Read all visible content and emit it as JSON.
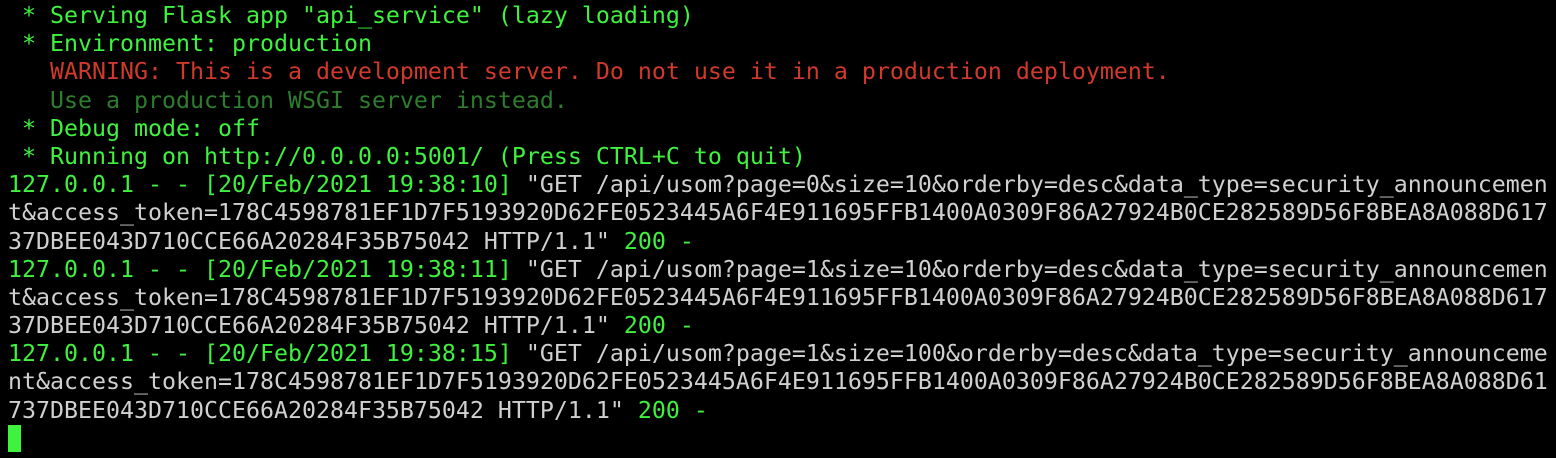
{
  "colors": {
    "green": "#3ef23e",
    "white": "#d0d0d0",
    "red": "#d0392b",
    "dark_green": "#2e7d2e"
  },
  "lines": {
    "serving": " * Serving Flask app \"api_service\" (lazy loading)",
    "environment": " * Environment: production",
    "warning": "   WARNING: This is a development server. Do not use it in a production deployment.",
    "wsgi": "   Use a production WSGI server instead.",
    "debug": " * Debug mode: off",
    "running": " * Running on http://0.0.0.0:5001/ (Press CTRL+C to quit)"
  },
  "requests": [
    {
      "prefix": "127.0.0.1 - - [20/Feb/2021 19:38:10] ",
      "l1": "\"GET /api/usom?page=0&size=10&orderby=desc&data_type=security_announcemen",
      "l2": "t&access_token=178C4598781EF1D7F5193920D62FE0523445A6F4E911695FFB1400A0309F86A27924B0CE282589D56F8BEA8A088D617",
      "l3": "37DBEE043D710CCE66A20284F35B75042 HTTP/1.1\" ",
      "status": "200 -"
    },
    {
      "prefix": "127.0.0.1 - - [20/Feb/2021 19:38:11] ",
      "l1": "\"GET /api/usom?page=1&size=10&orderby=desc&data_type=security_announcemen",
      "l2": "t&access_token=178C4598781EF1D7F5193920D62FE0523445A6F4E911695FFB1400A0309F86A27924B0CE282589D56F8BEA8A088D617",
      "l3": "37DBEE043D710CCE66A20284F35B75042 HTTP/1.1\" ",
      "status": "200 -"
    },
    {
      "prefix": "127.0.0.1 - - [20/Feb/2021 19:38:15] ",
      "l1": "\"GET /api/usom?page=1&size=100&orderby=desc&data_type=security_announceme",
      "l2": "nt&access_token=178C4598781EF1D7F5193920D62FE0523445A6F4E911695FFB1400A0309F86A27924B0CE282589D56F8BEA8A088D61",
      "l3": "737DBEE043D710CCE66A20284F35B75042 HTTP/1.1\" ",
      "status": "200 -"
    }
  ]
}
